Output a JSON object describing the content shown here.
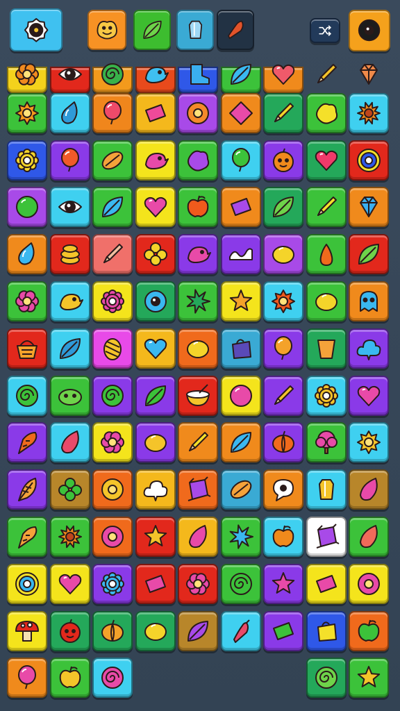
{
  "colors": {
    "background": "#364556",
    "tile_border": "#1d2530"
  },
  "topbar": {
    "items": [
      {
        "name": "settings-gear-button",
        "icon": "gear-icon",
        "bg": "#3fc1f0",
        "fg": "#f4c430",
        "interactable": true
      },
      {
        "name": "booster-blob-button",
        "icon": "smiley-blob-icon",
        "bg": "#f79224",
        "fg": "#f7c844",
        "interactable": true
      },
      {
        "name": "booster-leaf-button",
        "icon": "leaf-icon",
        "bg": "#3dbd2f",
        "fg": "#6ed34a",
        "interactable": true
      },
      {
        "name": "booster-crystal-button",
        "icon": "crystal-icon",
        "bg": "#3aaad4",
        "fg": "#9fd8f5",
        "interactable": true
      },
      {
        "name": "booster-chili-button",
        "icon": "chili-icon",
        "bg": "#223244",
        "fg": "#e2532a",
        "interactable": true
      },
      {
        "name": "shuffle-button",
        "icon": "shuffle-icon",
        "bg": "#223a5a",
        "fg": "#ffffff",
        "interactable": true
      },
      {
        "name": "profile-eye-button",
        "icon": "eye-icon",
        "bg": "#f5a11c",
        "fg": "#1c1c1c",
        "interactable": true
      }
    ]
  },
  "board": {
    "tiles": [
      {
        "bg": "#f4d21c",
        "icon": "flower-icon",
        "fg": "#f08a1f"
      },
      {
        "bg": "#e2281c",
        "icon": "eye-flower-icon",
        "fg": "#ffffff"
      },
      {
        "bg": "#f39a1c",
        "icon": "swirl-icon",
        "fg": "#38b24a"
      },
      {
        "bg": "#e84a1c",
        "icon": "bird-icon",
        "fg": "#3fbff0"
      },
      {
        "bg": "#2f58e8",
        "icon": "boot-icon",
        "fg": "#3aaff0"
      },
      {
        "bg": "#3cc23a",
        "icon": "leaf-icon",
        "fg": "#3ab8f0"
      },
      {
        "bg": "#f08a1c",
        "icon": "heart-icon",
        "fg": "#ef5a6a"
      },
      {
        "bg": "#364556",
        "icon": "pencil-icon",
        "fg": "#f4c42a"
      },
      {
        "bg": "#364556",
        "icon": "gem-icon",
        "fg": "#f08a4a"
      },
      {
        "bg": "#3cc23a",
        "icon": "sun-icon",
        "fg": "#f59a1c"
      },
      {
        "bg": "#3fd0f0",
        "icon": "drop-icon",
        "fg": "#2f9ad8"
      },
      {
        "bg": "#f0861c",
        "icon": "balloon-icon",
        "fg": "#ef4a6a"
      },
      {
        "bg": "#f4b81c",
        "icon": "bar-icon",
        "fg": "#ef4a9a"
      },
      {
        "bg": "#a84ae8",
        "icon": "donut-icon",
        "fg": "#f48a2a"
      },
      {
        "bg": "#f08a1c",
        "icon": "diamond-icon",
        "fg": "#e84aa8"
      },
      {
        "bg": "#24a85a",
        "icon": "pencil-icon",
        "fg": "#f4d42a"
      },
      {
        "bg": "#3cc23a",
        "icon": "blob-icon",
        "fg": "#f4e02a"
      },
      {
        "bg": "#3fd0f0",
        "icon": "sunflower-icon",
        "fg": "#f08a1c"
      },
      {
        "bg": "#2f58e8",
        "icon": "gear-flower-icon",
        "fg": "#f4d42a"
      },
      {
        "bg": "#8a3ae8",
        "icon": "balloon-icon",
        "fg": "#f05a2a"
      },
      {
        "bg": "#3cc23a",
        "icon": "almond-icon",
        "fg": "#f4a23a"
      },
      {
        "bg": "#f4e41c",
        "icon": "bird-icon",
        "fg": "#e84aa8"
      },
      {
        "bg": "#3cc23a",
        "icon": "blob-icon",
        "fg": "#a84ae8"
      },
      {
        "bg": "#3fd0f0",
        "icon": "balloon-icon",
        "fg": "#3cc23a"
      },
      {
        "bg": "#8a3ae8",
        "icon": "face-fruit-icon",
        "fg": "#f08a1c"
      },
      {
        "bg": "#24a85a",
        "icon": "heart-icon",
        "fg": "#ef3a6a"
      },
      {
        "bg": "#e2281c",
        "icon": "target-icon",
        "fg": "#2f58e8"
      },
      {
        "bg": "#a84ae8",
        "icon": "ball-icon",
        "fg": "#3cc23a"
      },
      {
        "bg": "#3fd0f0",
        "icon": "eye-flower-icon",
        "fg": "#ffffff"
      },
      {
        "bg": "#3cc23a",
        "icon": "leaf-icon",
        "fg": "#3ab8f0"
      },
      {
        "bg": "#f4e41c",
        "icon": "heart-icon",
        "fg": "#e84aa8"
      },
      {
        "bg": "#3cc23a",
        "icon": "apple-icon",
        "fg": "#f05a1c"
      },
      {
        "bg": "#f08a1c",
        "icon": "bar-icon",
        "fg": "#a84ae8"
      },
      {
        "bg": "#24a85a",
        "icon": "leaf-icon",
        "fg": "#6ed34a"
      },
      {
        "bg": "#3cc23a",
        "icon": "pencil-icon",
        "fg": "#f4e02a"
      },
      {
        "bg": "#f08a1c",
        "icon": "gem-icon",
        "fg": "#3aaff0"
      },
      {
        "bg": "#f08a1c",
        "icon": "drop-icon",
        "fg": "#3ab8f0"
      },
      {
        "bg": "#e2281c",
        "icon": "coin-stack-icon",
        "fg": "#f4c42a"
      },
      {
        "bg": "#f0706a",
        "icon": "pencil-icon",
        "fg": "#f0c0a0"
      },
      {
        "bg": "#e2281c",
        "icon": "clover-icon",
        "fg": "#f4d42a"
      },
      {
        "bg": "#8a3ae8",
        "icon": "bird-icon",
        "fg": "#e84aa8"
      },
      {
        "bg": "#8a3ae8",
        "icon": "wave-icon",
        "fg": "#ffffff"
      },
      {
        "bg": "#a84ae8",
        "icon": "lemon-icon",
        "fg": "#f4d42a"
      },
      {
        "bg": "#3cc23a",
        "icon": "pear-icon",
        "fg": "#f06a1c"
      },
      {
        "bg": "#e2281c",
        "icon": "leaf-icon",
        "fg": "#6ed34a"
      },
      {
        "bg": "#3cc23a",
        "icon": "flower-icon",
        "fg": "#e84aa8"
      },
      {
        "bg": "#3fd0f0",
        "icon": "bird-icon",
        "fg": "#f4c42a"
      },
      {
        "bg": "#f4e41c",
        "icon": "gear-flower-icon",
        "fg": "#e84aa8"
      },
      {
        "bg": "#24a85a",
        "icon": "eye-icon",
        "fg": "#3ab8f0"
      },
      {
        "bg": "#3cc23a",
        "icon": "star-burst-icon",
        "fg": "#24a85a"
      },
      {
        "bg": "#f4e41c",
        "icon": "star-icon",
        "fg": "#f4a22a"
      },
      {
        "bg": "#3fd0f0",
        "icon": "sun-icon",
        "fg": "#f05a1c"
      },
      {
        "bg": "#3cc23a",
        "icon": "lemon-icon",
        "fg": "#f4d42a"
      },
      {
        "bg": "#f08a1c",
        "icon": "ghost-icon",
        "fg": "#3ab8f0"
      },
      {
        "bg": "#e2281c",
        "icon": "basket-icon",
        "fg": "#f4a22a"
      },
      {
        "bg": "#3fd0f0",
        "icon": "leaf-icon",
        "fg": "#2f9ad8"
      },
      {
        "bg": "#e84ae8",
        "icon": "egg-icon",
        "fg": "#f4c42a"
      },
      {
        "bg": "#f4b81c",
        "icon": "heart-icon",
        "fg": "#3ab8f0"
      },
      {
        "bg": "#f06a1c",
        "icon": "lemon-icon",
        "fg": "#f4d42a"
      },
      {
        "bg": "#3aaad4",
        "icon": "bag-icon",
        "fg": "#5a4ab8"
      },
      {
        "bg": "#8a3ae8",
        "icon": "balloon-icon",
        "fg": "#f4a22a"
      },
      {
        "bg": "#24a85a",
        "icon": "cup-icon",
        "fg": "#f4a23a"
      },
      {
        "bg": "#8a3ae8",
        "icon": "cloud-icon",
        "fg": "#3ab8f0"
      },
      {
        "bg": "#3fd0f0",
        "icon": "swirl-icon",
        "fg": "#3cc23a"
      },
      {
        "bg": "#3cc23a",
        "icon": "face-blob-icon",
        "fg": "#6ed34a"
      },
      {
        "bg": "#8a3ae8",
        "icon": "swirl-icon",
        "fg": "#3cc23a"
      },
      {
        "bg": "#8a3ae8",
        "icon": "leaf-icon",
        "fg": "#3cc23a"
      },
      {
        "bg": "#e2281c",
        "icon": "bowl-icon",
        "fg": "#f4c42a"
      },
      {
        "bg": "#f4e41c",
        "icon": "ball-icon",
        "fg": "#e84aa8"
      },
      {
        "bg": "#8a3ae8",
        "icon": "pencil-icon",
        "fg": "#f4c42a"
      },
      {
        "bg": "#3fd0f0",
        "icon": "gear-flower-icon",
        "fg": "#f4c42a"
      },
      {
        "bg": "#8a3ae8",
        "icon": "heart-icon",
        "fg": "#e84aa8"
      },
      {
        "bg": "#8a3ae8",
        "icon": "carrot-icon",
        "fg": "#f06a1c"
      },
      {
        "bg": "#3fd0f0",
        "icon": "seed-icon",
        "fg": "#e84a6a"
      },
      {
        "bg": "#f4e41c",
        "icon": "flower-icon",
        "fg": "#e84aa8"
      },
      {
        "bg": "#8a3ae8",
        "icon": "lemon-icon",
        "fg": "#f4c42a"
      },
      {
        "bg": "#f08a1c",
        "icon": "pencil-icon",
        "fg": "#f4e02a"
      },
      {
        "bg": "#f08a1c",
        "icon": "leaf-icon",
        "fg": "#3ab8f0"
      },
      {
        "bg": "#8a3ae8",
        "icon": "pumpkin-icon",
        "fg": "#f06a1c"
      },
      {
        "bg": "#3cc23a",
        "icon": "tree-icon",
        "fg": "#e84aa8"
      },
      {
        "bg": "#3fd0f0",
        "icon": "sun-icon",
        "fg": "#f4c42a"
      },
      {
        "bg": "#8a3ae8",
        "icon": "feather-icon",
        "fg": "#f4a23a"
      },
      {
        "bg": "#b8862a",
        "icon": "clover-icon",
        "fg": "#3cc23a"
      },
      {
        "bg": "#f06a1c",
        "icon": "donut-icon",
        "fg": "#f4c42a"
      },
      {
        "bg": "#f4b81c",
        "icon": "cloud-icon",
        "fg": "#ffffff"
      },
      {
        "bg": "#f06a1c",
        "icon": "gift-icon",
        "fg": "#a84ae8"
      },
      {
        "bg": "#3aaad4",
        "icon": "almond-icon",
        "fg": "#f4a23a"
      },
      {
        "bg": "#f08a1c",
        "icon": "bubble-icon",
        "fg": "#ffffff"
      },
      {
        "bg": "#3fd0f0",
        "icon": "crystal-icon",
        "fg": "#f4c42a"
      },
      {
        "bg": "#b8862a",
        "icon": "seed-icon",
        "fg": "#e84aa8"
      },
      {
        "bg": "#3cc23a",
        "icon": "carrot-icon",
        "fg": "#f4a23a"
      },
      {
        "bg": "#3cc23a",
        "icon": "sunflower-icon",
        "fg": "#f08a1c"
      },
      {
        "bg": "#f06a1c",
        "icon": "donut-icon",
        "fg": "#e84aa8"
      },
      {
        "bg": "#e2281c",
        "icon": "star-icon",
        "fg": "#f4c42a"
      },
      {
        "bg": "#f4b81c",
        "icon": "seed-icon",
        "fg": "#e84aa8"
      },
      {
        "bg": "#3cc23a",
        "icon": "star-burst-icon",
        "fg": "#3ab8f0"
      },
      {
        "bg": "#3fd0f0",
        "icon": "apple-icon",
        "fg": "#f08a1c"
      },
      {
        "bg": "#ffffff",
        "icon": "gift-icon",
        "fg": "#a84ae8"
      },
      {
        "bg": "#3cc23a",
        "icon": "seed-icon",
        "fg": "#f06a5a"
      },
      {
        "bg": "#f4e41c",
        "icon": "target-icon",
        "fg": "#3ab8f0"
      },
      {
        "bg": "#f4e41c",
        "icon": "heart-icon",
        "fg": "#e84aa8"
      },
      {
        "bg": "#8a3ae8",
        "icon": "gear-flower-icon",
        "fg": "#3ab8f0"
      },
      {
        "bg": "#e2281c",
        "icon": "bar-icon",
        "fg": "#e84aa8"
      },
      {
        "bg": "#e2281c",
        "icon": "flower-icon",
        "fg": "#e84aa8"
      },
      {
        "bg": "#3cc23a",
        "icon": "swirl-icon",
        "fg": "#3cc23a"
      },
      {
        "bg": "#8a3ae8",
        "icon": "star-icon",
        "fg": "#e84aa8"
      },
      {
        "bg": "#f4e41c",
        "icon": "bar-icon",
        "fg": "#e84aa8"
      },
      {
        "bg": "#f4e41c",
        "icon": "donut-icon",
        "fg": "#e84aa8"
      },
      {
        "bg": "#f4e41c",
        "icon": "mushroom-icon",
        "fg": "#e2281c"
      },
      {
        "bg": "#24a85a",
        "icon": "face-fruit-icon",
        "fg": "#e2281c"
      },
      {
        "bg": "#24a85a",
        "icon": "pumpkin-icon",
        "fg": "#f4a22a"
      },
      {
        "bg": "#24a85a",
        "icon": "lemon-icon",
        "fg": "#f4d42a"
      },
      {
        "bg": "#b8862a",
        "icon": "leaf-icon",
        "fg": "#a84ae8"
      },
      {
        "bg": "#3fd0f0",
        "icon": "pepper-icon",
        "fg": "#e84a6a"
      },
      {
        "bg": "#8a3ae8",
        "icon": "bar-icon",
        "fg": "#3cc23a"
      },
      {
        "bg": "#2f58e8",
        "icon": "bag-icon",
        "fg": "#f4e02a"
      },
      {
        "bg": "#f06a1c",
        "icon": "apple-icon",
        "fg": "#3cc23a"
      },
      {
        "bg": "#f08a1c",
        "icon": "balloon-icon",
        "fg": "#e84aa8"
      },
      {
        "bg": "#3cc23a",
        "icon": "apple-icon",
        "fg": "#f4c42a"
      },
      {
        "bg": "#3fd0f0",
        "icon": "swirl-icon",
        "fg": "#e84aa8"
      },
      {
        "bg": "none",
        "icon": "empty",
        "fg": "none"
      },
      {
        "bg": "none",
        "icon": "empty",
        "fg": "none"
      },
      {
        "bg": "none",
        "icon": "empty",
        "fg": "none"
      },
      {
        "bg": "none",
        "icon": "empty",
        "fg": "none"
      },
      {
        "bg": "#24a85a",
        "icon": "swirl-icon",
        "fg": "#6ed34a"
      },
      {
        "bg": "#3cc23a",
        "icon": "star-icon",
        "fg": "#f4c42a"
      }
    ]
  }
}
